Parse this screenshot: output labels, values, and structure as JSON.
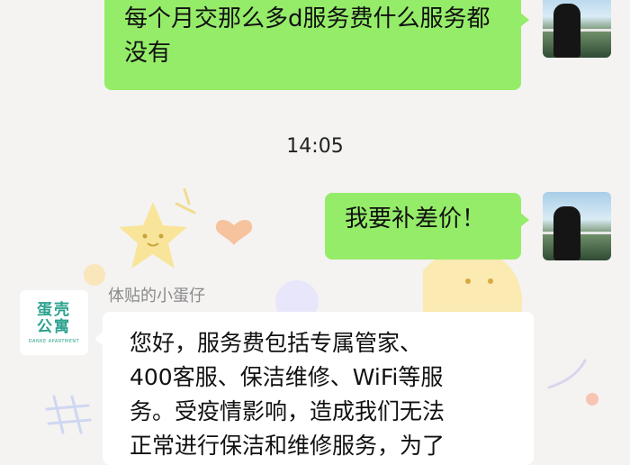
{
  "chat": {
    "messages": [
      {
        "text": "每个月交那么多d服务费什么服务都没有"
      },
      {
        "text": "我要补差价！"
      }
    ],
    "timestamp": "14:05",
    "reply": {
      "sender": "体贴的小蛋仔",
      "lines": [
        "您好，服务费包括专属管家、",
        "400客服、保洁维修、WiFi等服",
        "务。受疫情影响，造成我们无法",
        "正常进行保洁和维修服务，为了"
      ]
    },
    "brand": {
      "name": "蛋壳公寓",
      "sub": "DANKE APARTMENT",
      "color": "#2aa28e"
    }
  },
  "colors": {
    "outgoing": "#95ec69",
    "incoming": "#ffffff",
    "background": "#f4f3f2"
  }
}
